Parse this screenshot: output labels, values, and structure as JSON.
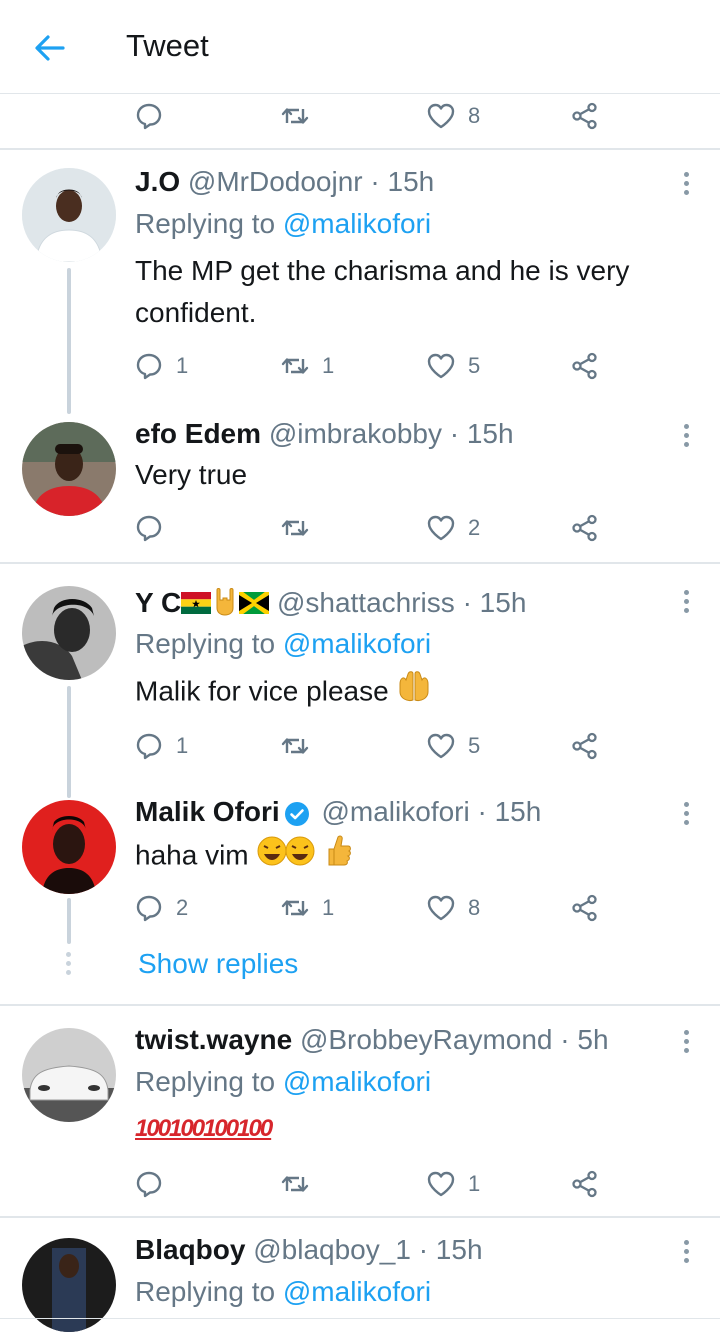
{
  "header": {
    "title": "Tweet"
  },
  "top_actions": {
    "likes": "8"
  },
  "tweets": [
    {
      "name": "J.O",
      "handle": "@MrDodoojnr",
      "time": "15h",
      "replying_prefix": "Replying to",
      "replying_to": "@malikofori",
      "text": "The MP get the charisma and he is very confident.",
      "replies": "1",
      "retweets": "1",
      "likes": "5"
    },
    {
      "name": "efo Edem",
      "handle": "@imbrakobby",
      "time": "15h",
      "text": "Very true",
      "replies": "",
      "retweets": "",
      "likes": "2"
    },
    {
      "name": "Y C",
      "handle": "@shattachriss",
      "time": "15h",
      "replying_prefix": "Replying to",
      "replying_to": "@malikofori",
      "text": "Malik for vice please",
      "replies": "1",
      "retweets": "",
      "likes": "5"
    },
    {
      "name": "Malik Ofori",
      "handle": "@malikofori",
      "time": "15h",
      "text": "haha vim",
      "replies": "2",
      "retweets": "1",
      "likes": "8",
      "show_replies": "Show replies"
    },
    {
      "name": "twist.wayne",
      "handle": "@BrobbeyRaymond",
      "time": "5h",
      "replying_prefix": "Replying to",
      "replying_to": "@malikofori",
      "text": "100100100100",
      "replies": "",
      "retweets": "",
      "likes": "1"
    },
    {
      "name": "Blaqboy",
      "handle": "@blaqboy_1",
      "time": "15h",
      "replying_prefix": "Replying to",
      "replying_to": "@malikofori"
    }
  ],
  "colors": {
    "accent": "#1da1f2",
    "muted": "#657786",
    "divider": "#e1e6ea",
    "thread": "#c9d3dc"
  },
  "icons": [
    "back-arrow-icon",
    "reply-icon",
    "retweet-icon",
    "heart-icon",
    "share-icon",
    "more-icon",
    "verified-icon"
  ]
}
